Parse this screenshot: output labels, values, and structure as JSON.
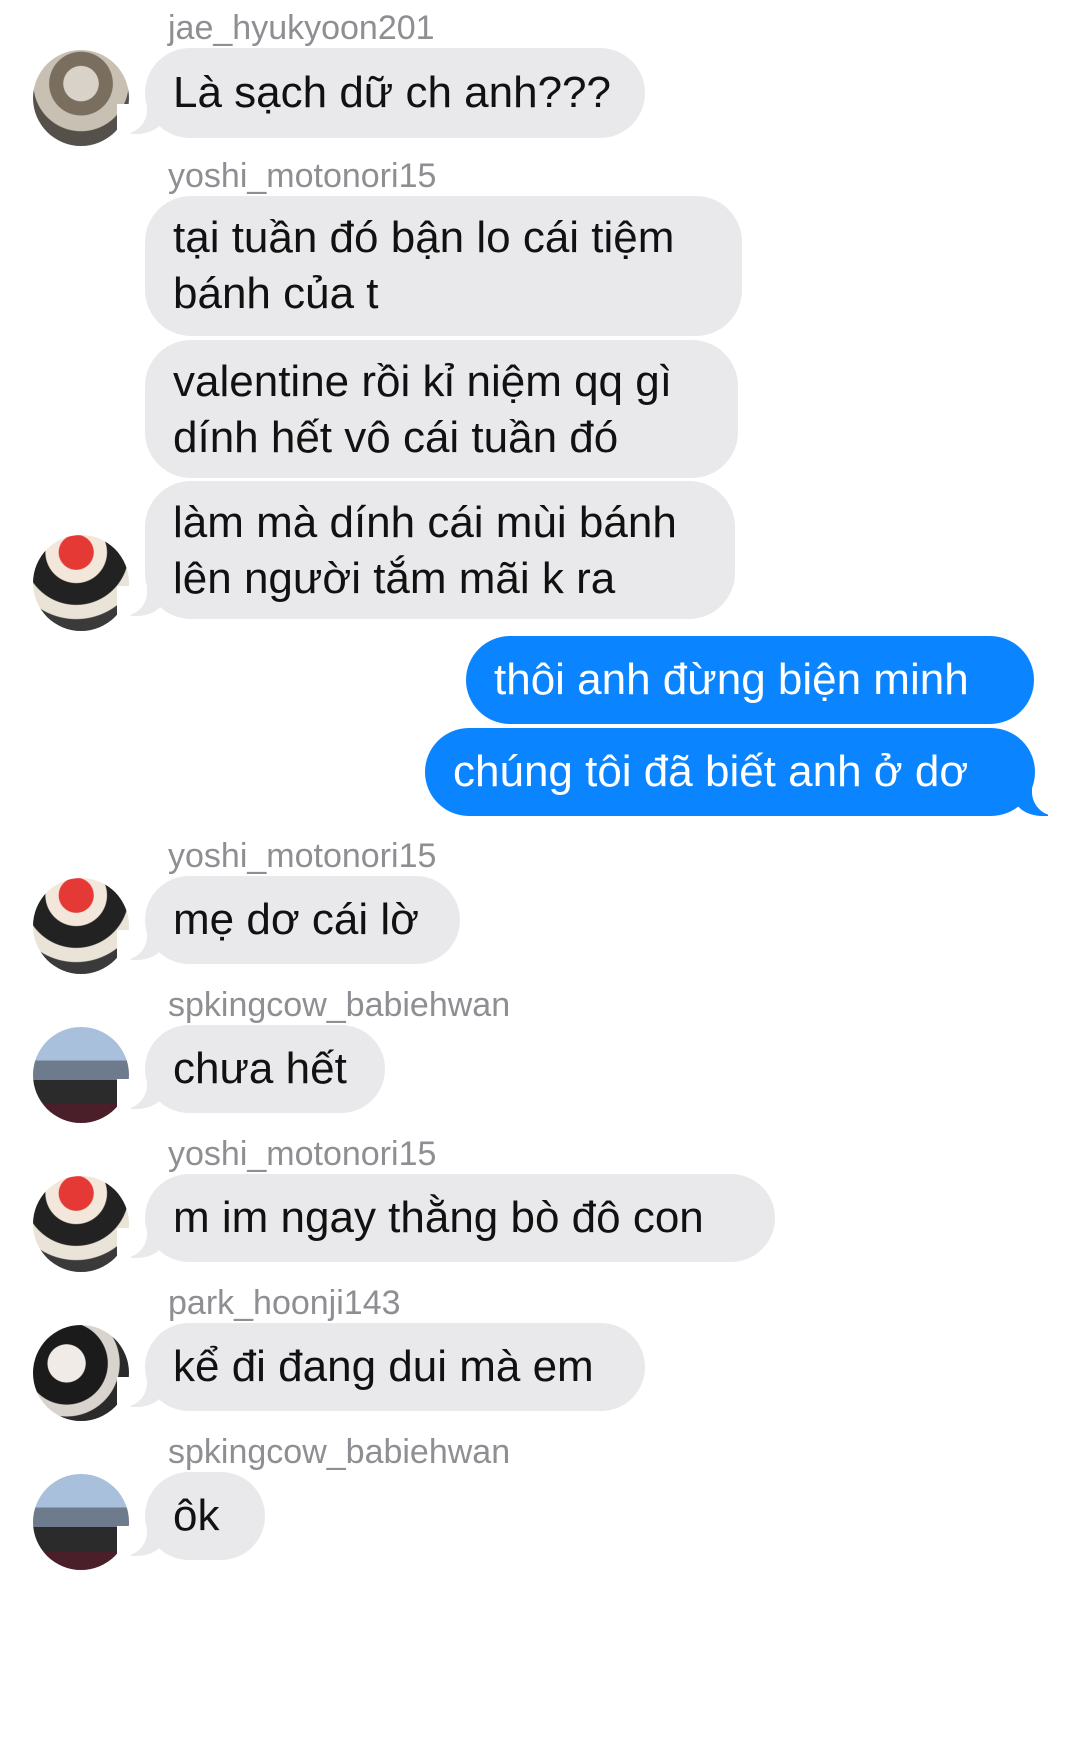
{
  "messages": [
    {
      "sender": "jae_hyukyoon201",
      "text": "Là sạch dữ ch anh???"
    },
    {
      "sender": "yoshi_motonori15",
      "text": "tại tuần đó bận lo cái tiệm\nbánh của t"
    },
    {
      "text": "valentine rồi kỉ niệm qq gì\ndính hết vô cái tuần đó"
    },
    {
      "text": "làm mà dính cái mùi bánh\nlên người tắm mãi k ra"
    },
    {
      "text": "thôi anh đừng biện minh"
    },
    {
      "text": "chúng tôi đã biết anh ở dơ"
    },
    {
      "sender": "yoshi_motonori15",
      "text": "mẹ dơ cái lờ"
    },
    {
      "sender": "spkingcow_babiehwan",
      "text": "chưa hết"
    },
    {
      "sender": "yoshi_motonori15",
      "text": "m im ngay thằng bò đô con"
    },
    {
      "sender": "park_hoonji143",
      "text": "kể đi đang dui mà em"
    },
    {
      "sender": "spkingcow_babiehwan",
      "text": "ôk"
    }
  ],
  "colors": {
    "received_bubble": "#e9e9eb",
    "sent_bubble": "#0b84ff",
    "sender_name": "#8e8e93"
  }
}
